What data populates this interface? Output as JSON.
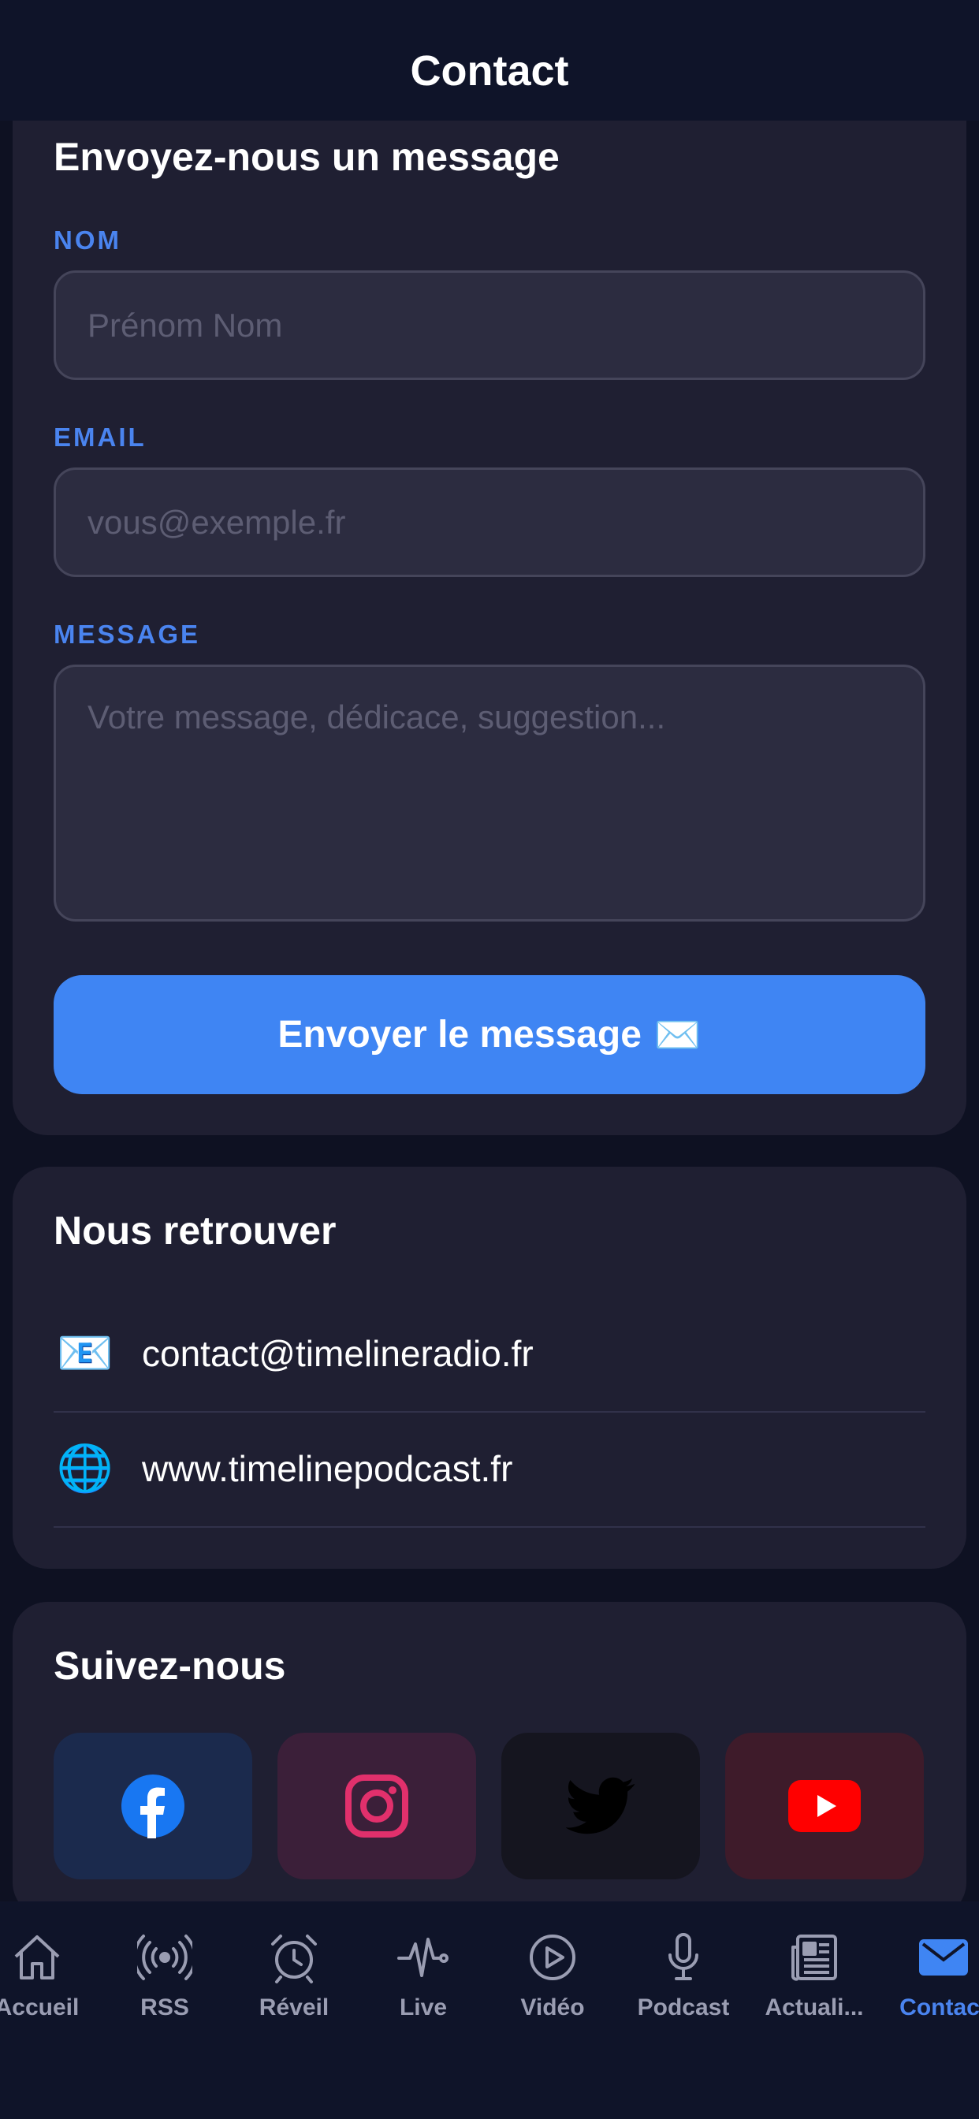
{
  "header": {
    "title": "Contact"
  },
  "form": {
    "title": "Envoyez-nous un message",
    "name_label": "NOM",
    "name_placeholder": "Prénom Nom",
    "email_label": "EMAIL",
    "email_placeholder": "vous@exemple.fr",
    "message_label": "MESSAGE",
    "message_placeholder": "Votre message, dédicace, suggestion...",
    "send_label": "Envoyer le message",
    "send_emoji": "✉️"
  },
  "find_us": {
    "title": "Nous retrouver",
    "items": [
      {
        "icon": "email-icon",
        "emoji": "📧",
        "text": "contact@timelineradio.fr"
      },
      {
        "icon": "globe-icon",
        "emoji": "🌐",
        "text": "www.timelinepodcast.fr"
      }
    ]
  },
  "follow_us": {
    "title": "Suivez-nous",
    "networks": [
      {
        "name": "facebook-icon",
        "color": "#1877f2",
        "bg": "#1b2a4d"
      },
      {
        "name": "instagram-icon",
        "color": "#e1306c",
        "bg": "#3b1f39"
      },
      {
        "name": "twitter-icon",
        "color": "#000000",
        "bg": "#15151f"
      },
      {
        "name": "youtube-icon",
        "color": "#ff0000",
        "bg": "#3e1b2a"
      }
    ]
  },
  "tabbar": {
    "active": "Contact",
    "tabs": [
      {
        "label": "Accueil",
        "icon": "home-icon"
      },
      {
        "label": "RSS",
        "icon": "broadcast-icon"
      },
      {
        "label": "Réveil",
        "icon": "alarm-icon"
      },
      {
        "label": "Live",
        "icon": "pulse-icon"
      },
      {
        "label": "Vidéo",
        "icon": "play-icon"
      },
      {
        "label": "Podcast",
        "icon": "microphone-icon"
      },
      {
        "label": "Actuali...",
        "icon": "newspaper-icon"
      },
      {
        "label": "Contact",
        "icon": "envelope-icon"
      }
    ]
  },
  "colors": {
    "accent": "#3f85f3",
    "label": "#4a84ef",
    "card": "#1f1f32",
    "background": "#0e1122"
  }
}
